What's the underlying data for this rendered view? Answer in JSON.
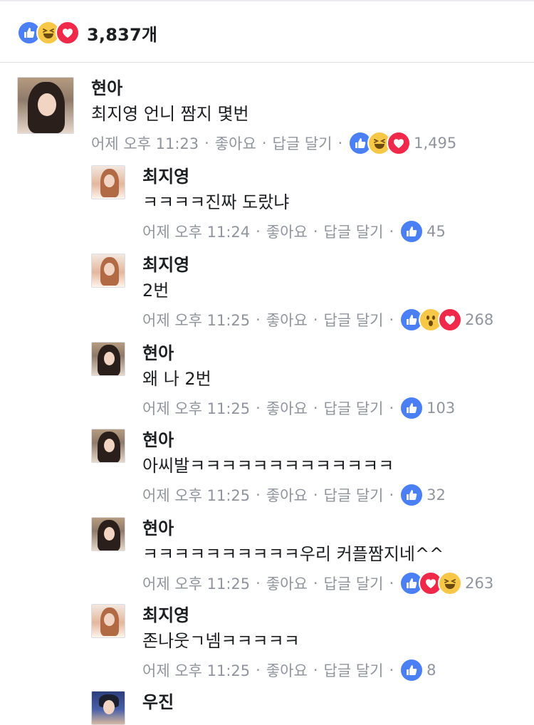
{
  "summary": {
    "reactions": [
      "like-icon",
      "haha-icon",
      "love-icon"
    ],
    "count": "3,837개"
  },
  "comments": [
    {
      "name": "현아",
      "text": "최지영 언니 짬지 몇번",
      "time": "어제 오후 11:23",
      "like_label": "좋아요",
      "reply_label": "답글 달기",
      "reactions": [
        "like-icon",
        "haha-icon",
        "love-icon"
      ],
      "reaction_count": "1,495"
    },
    {
      "name": "최지영",
      "text": "ㅋㅋㅋㅋ진짜 도랐냐",
      "time": "어제 오후 11:24",
      "like_label": "좋아요",
      "reply_label": "답글 달기",
      "reactions": [
        "like-icon"
      ],
      "reaction_count": "45"
    },
    {
      "name": "최지영",
      "text": "2번",
      "time": "어제 오후 11:25",
      "like_label": "좋아요",
      "reply_label": "답글 달기",
      "reactions": [
        "like-icon",
        "wow-icon",
        "love-icon"
      ],
      "reaction_count": "268"
    },
    {
      "name": "현아",
      "text": "왜 나 2번",
      "time": "어제 오후 11:25",
      "like_label": "좋아요",
      "reply_label": "답글 달기",
      "reactions": [
        "like-icon"
      ],
      "reaction_count": "103"
    },
    {
      "name": "현아",
      "text": "아씨발ㅋㅋㅋㅋㅋㅋㅋㅋㅋㅋㅋㅋㅋ",
      "time": "어제 오후 11:25",
      "like_label": "좋아요",
      "reply_label": "답글 달기",
      "reactions": [
        "like-icon"
      ],
      "reaction_count": "32"
    },
    {
      "name": "현아",
      "text": "ㅋㅋㅋㅋㅋㅋㅋㅋㅋㅋ우리 커플짬지네^^",
      "time": "어제 오후 11:25",
      "like_label": "좋아요",
      "reply_label": "답글 달기",
      "reactions": [
        "like-icon",
        "love-icon",
        "haha-icon"
      ],
      "reaction_count": "263"
    },
    {
      "name": "최지영",
      "text": "존나웃ㄱ넴ㅋㅋㅋㅋㅋ",
      "time": "어제 오후 11:25",
      "like_label": "좋아요",
      "reply_label": "답글 달기",
      "reactions": [
        "like-icon"
      ],
      "reaction_count": "8"
    },
    {
      "name": "우진"
    }
  ],
  "separator": "·",
  "colors": {
    "like": "#4a7ff5",
    "love": "#f0284a",
    "haha": "#f7c847",
    "meta_text": "#90949c",
    "name_text": "#1c1e21"
  }
}
